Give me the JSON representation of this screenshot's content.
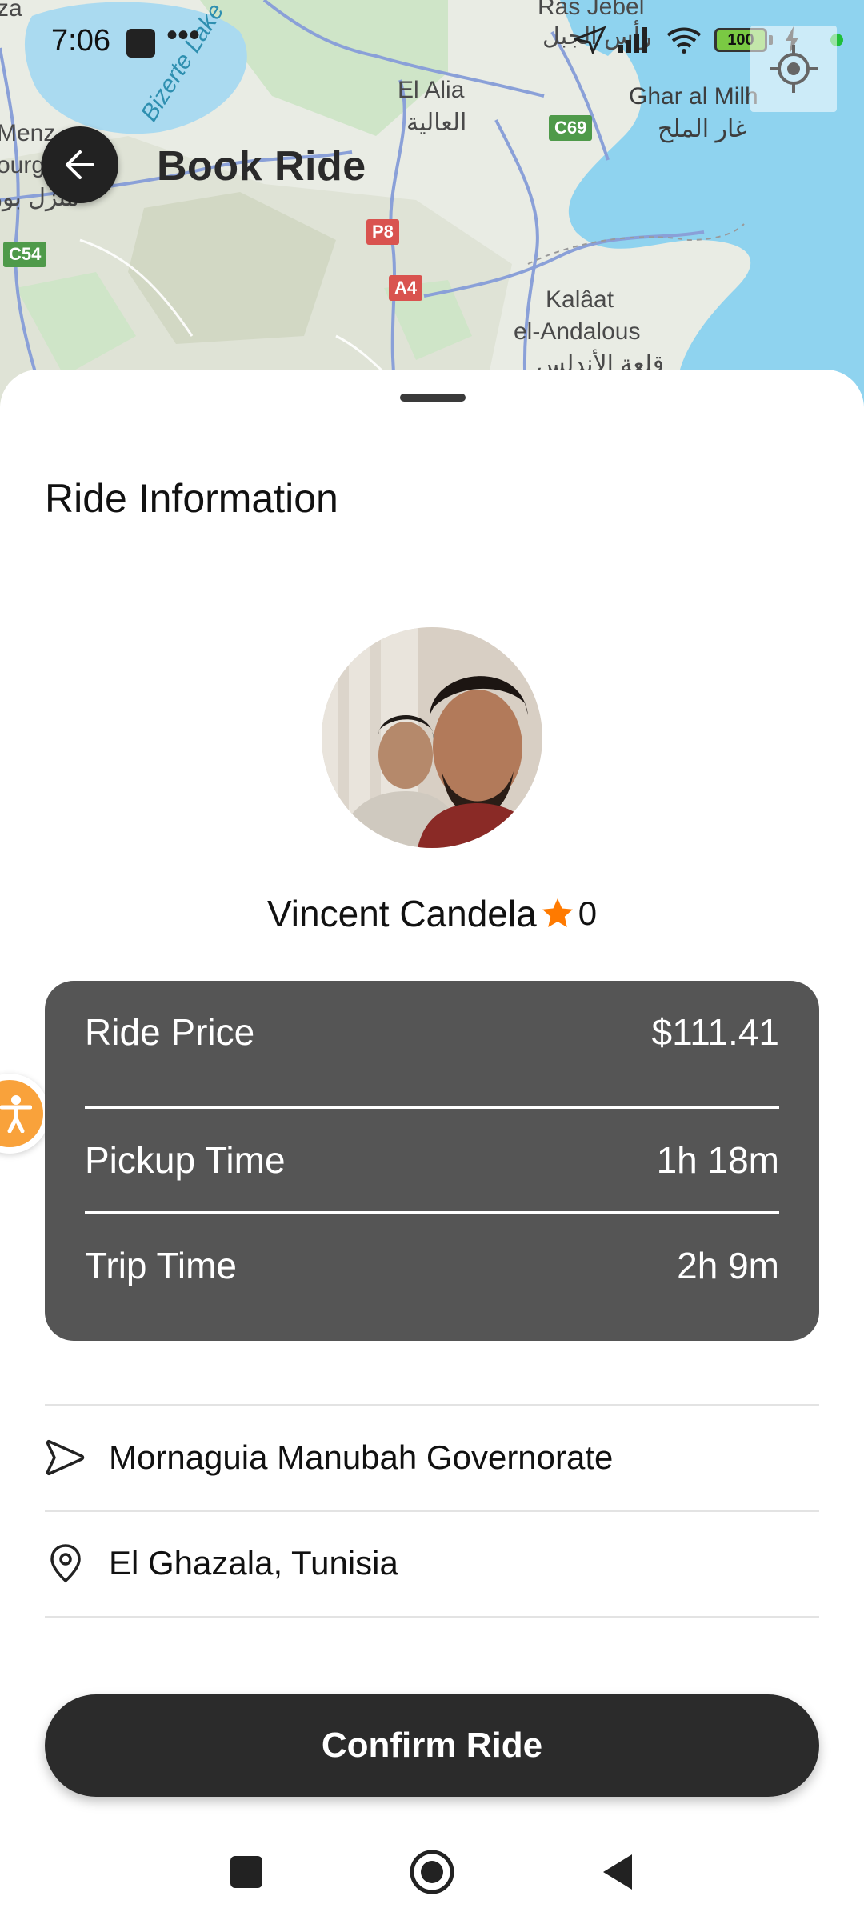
{
  "status_bar": {
    "time": "7:06",
    "dots": "•••",
    "battery": "100"
  },
  "map": {
    "labels": {
      "ras_jebel": "Ras Jebel",
      "ras_jebel_ar": "رأس الجبل",
      "bizerte_lake": "Bizerte Lake",
      "el_alia": "El Alia",
      "el_alia_ar": "العالية",
      "ghar_al_milh": "Ghar al Milh",
      "ghar_al_milh_ar": "غار الملح",
      "menzel": "Menz",
      "bourg": "ourg",
      "menzel_ar": "منزل بورقيبة",
      "kalaat": "Kalâat",
      "el_andalous": "el-Andalous",
      "kalaat_ar": "قلعة الأندلس",
      "za": "za"
    },
    "roads": {
      "c69": "C69",
      "c54": "C54",
      "p8": "P8",
      "a4": "A4"
    }
  },
  "header": {
    "title": "Book Ride"
  },
  "sheet": {
    "section_title": "Ride Information",
    "driver": {
      "name": "Vincent Candela",
      "rating": "0"
    },
    "info": [
      {
        "label": "Ride Price",
        "value": "$111.41"
      },
      {
        "label": "Pickup Time",
        "value": "1h 18m"
      },
      {
        "label": "Trip Time",
        "value": "2h 9m"
      }
    ],
    "pickup": "Mornaguia Manubah Governorate",
    "destination": "El Ghazala, Tunisia",
    "confirm_label": "Confirm Ride"
  },
  "colors": {
    "accent_orange": "#f9a23b",
    "card_bg": "#555555",
    "button_bg": "#2b2b2b",
    "star": "#ff7a00"
  }
}
